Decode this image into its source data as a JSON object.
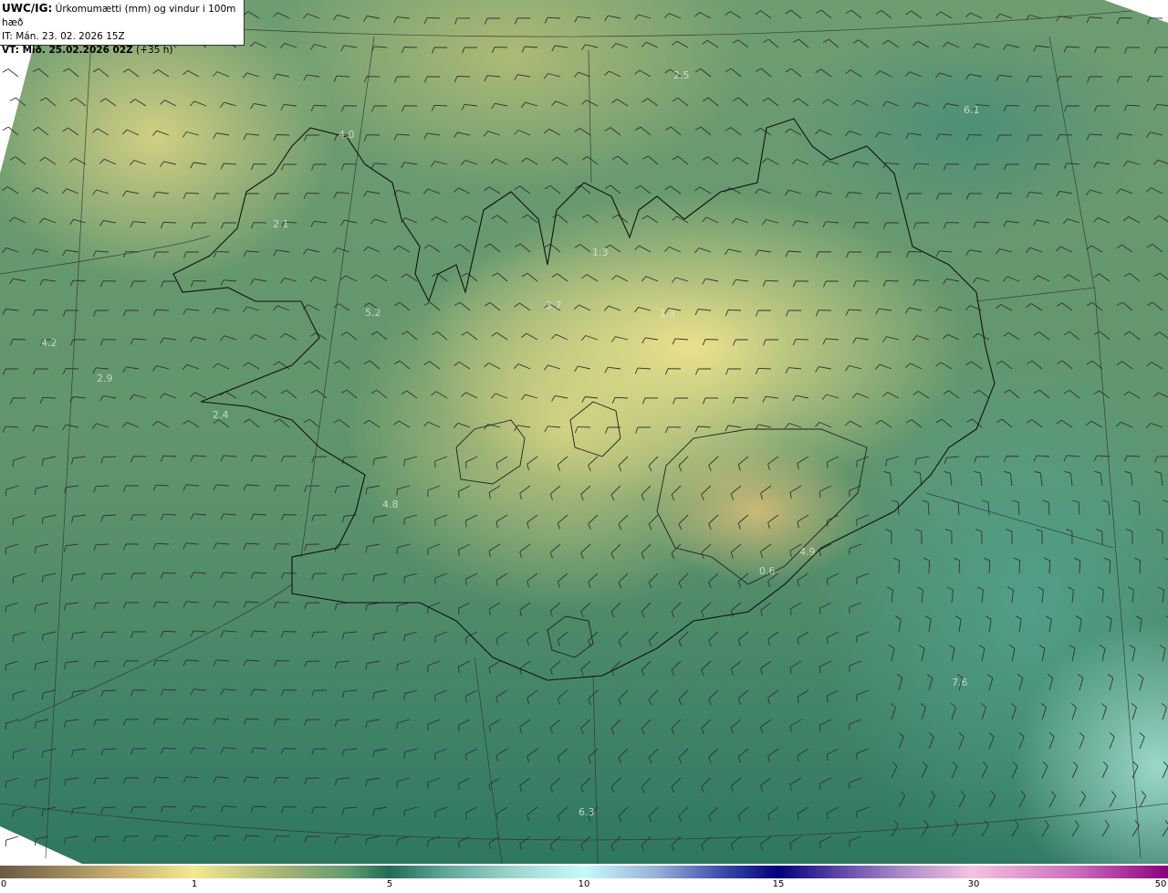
{
  "header": {
    "model": "UWC/IG:",
    "parameter": "Úrkomumætti (mm) og vindur i 100m hæð",
    "init_time": "IT: Mán. 23. 02. 2026 15Z",
    "valid_label": "VT: Mið. 25.02.2026 02Z",
    "lead_time": "(+35 h)"
  },
  "value_labels": [
    "2.5",
    "6.1",
    "4.0",
    "2.1",
    "1.3",
    "3.7",
    "5.2",
    "1.3",
    "4.2",
    "2.9",
    "2.4",
    "4.8",
    "4.9",
    "0.6",
    "7.6",
    "6.3"
  ],
  "colorbar": {
    "ticks": [
      "0",
      "1",
      "5",
      "10",
      "15",
      "30",
      "50"
    ],
    "colors": [
      "#6b5a45",
      "#f4e890",
      "#216b56",
      "#c8f9f9",
      "#00007c",
      "#f6c2e0",
      "#8c007e"
    ]
  },
  "map_layers": [
    "precipitation-field",
    "wind-barbs",
    "coastline",
    "lat-lon-grid"
  ]
}
